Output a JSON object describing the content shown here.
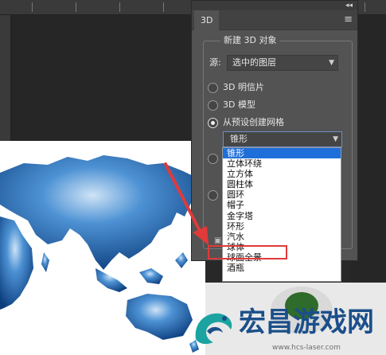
{
  "panel": {
    "tab_title": "3D",
    "collapse_glyph": "◂◂",
    "menu_icon": "menu-icon",
    "section_label": "新建 3D 对象",
    "source_label": "源:",
    "source_value": "选中的图层",
    "options": [
      {
        "label": "3D 明信片",
        "checked": false
      },
      {
        "label": "3D 模型",
        "checked": false
      },
      {
        "label": "从预设创建网格",
        "checked": true
      }
    ],
    "mesh_value": "锥形"
  },
  "dropdown": {
    "items": [
      "锥形",
      "立体环绕",
      "立方体",
      "圆柱体",
      "圆环",
      "帽子",
      "金字塔",
      "环形",
      "汽水",
      "球体",
      "球面全景",
      "酒瓶"
    ],
    "selected_index": 0,
    "highlighted_item": "球体"
  },
  "watermark": {
    "brand": "宏昌游戏网",
    "url": "www.hcs-laser.com"
  },
  "colors": {
    "panel_bg": "#535353",
    "accent_blue": "#1e6fd9",
    "annotation_red": "#e03a3a",
    "brand_blue": "#1b4f8a"
  }
}
